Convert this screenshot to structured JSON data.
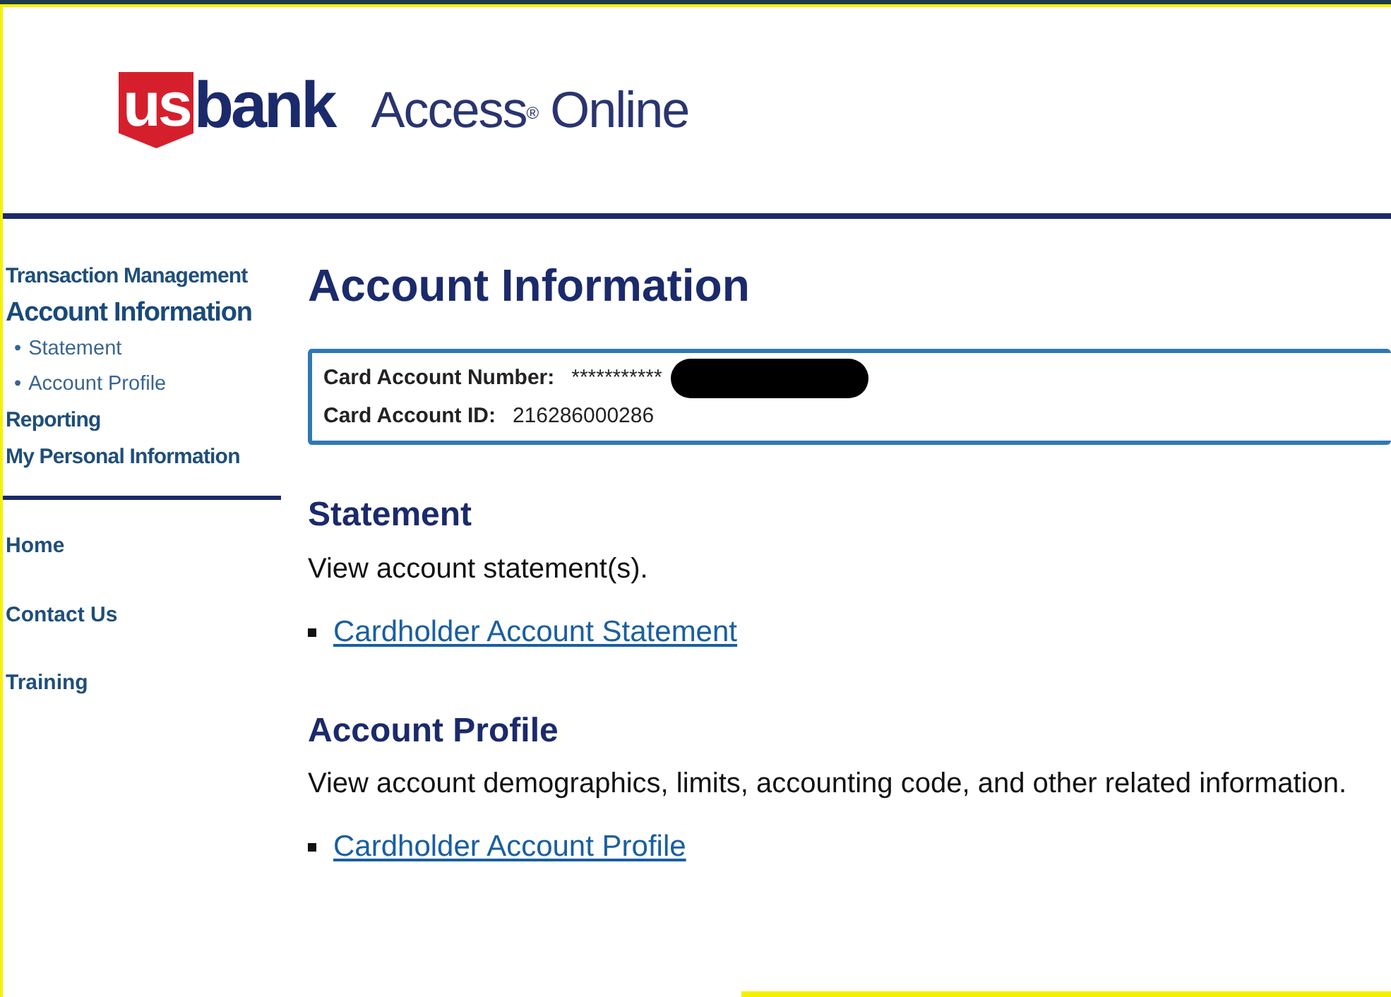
{
  "header": {
    "logo_mark": "us",
    "logo_word": "bank",
    "product": "Access$^{®}$ Online"
  },
  "sidebar": {
    "items": [
      {
        "label": "Transaction Management",
        "selected": false
      },
      {
        "label": "Account Information",
        "selected": true,
        "children": [
          {
            "bullet": "•",
            "label": "Statement"
          },
          {
            "bullet": "•",
            "label": "Account Profile"
          }
        ]
      },
      {
        "label": "Reporting",
        "selected": false
      },
      {
        "label": "My Personal Information",
        "selected": false
      }
    ],
    "links": [
      "Home",
      "Contact Us",
      "Training"
    ]
  },
  "main": {
    "title": "Account Information",
    "account": [
      {
        "label": "Card Account Number:",
        "value": "***********",
        "redacted": true
      },
      {
        "label": "Card Account ID:",
        "value": "216286000286"
      }
    ],
    "sections": [
      {
        "heading": "Statement",
        "description": "View account statement(s).",
        "link": "Cardholder Account Statement"
      },
      {
        "heading": "Account Profile",
        "description": "View account demographics, limits, accounting code, and other related information.",
        "link": "Cardholder Account Profile"
      }
    ]
  }
}
